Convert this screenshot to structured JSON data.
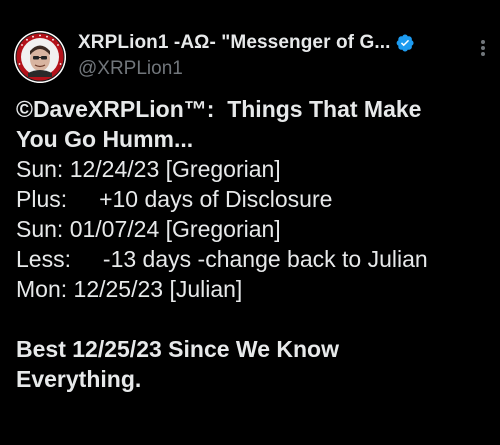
{
  "tweet": {
    "display_name": "XRPLion1 -AΩ- \"Messenger of G...",
    "handle": "@XRPLion1",
    "verified_color": "#1d9bf0",
    "avatar_icon": "lion-avatar",
    "more_icon": "more-vertical-icon",
    "title_lines": [
      "©DaveXRPLion™:  Things That Make",
      "You Go Humm..."
    ],
    "lines": [
      "Sun: 12/24/23 [Gregorian]",
      "Plus:     +10 days of Disclosure",
      "Sun: 01/07/24 [Gregorian]",
      "Less:     -13 days -change back to Julian",
      "Mon: 12/25/23 [Julian]"
    ],
    "closing_lines": [
      "Best 12/25/23 Since We Know",
      "Everything."
    ]
  }
}
